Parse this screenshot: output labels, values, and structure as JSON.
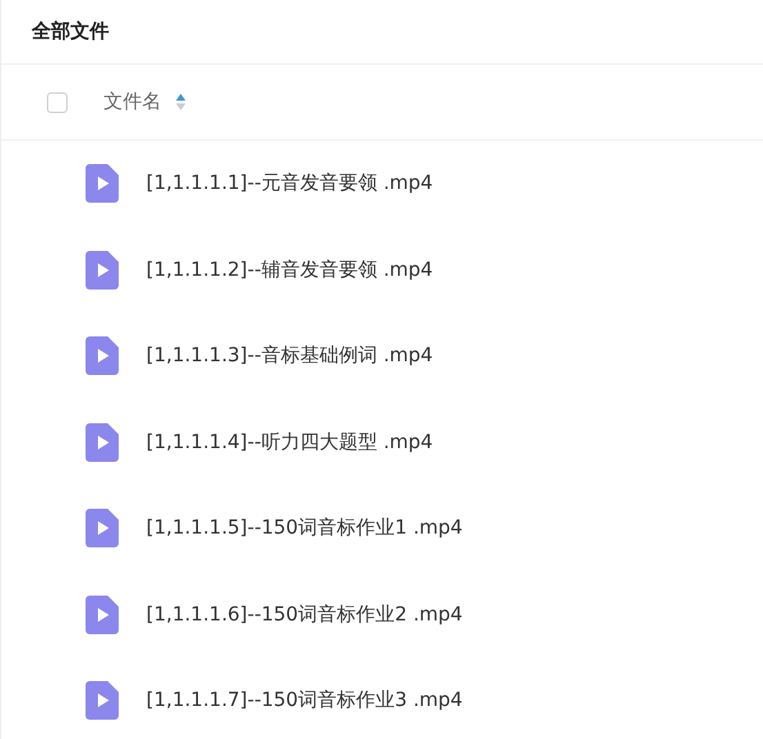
{
  "title": "全部文件",
  "header": {
    "checked": false,
    "column": "文件名",
    "ascending": true
  },
  "files": [
    {
      "name": "[1,1.1.1.1]--元音发音要领 .mp4"
    },
    {
      "name": "[1,1.1.1.2]--辅音发音要领 .mp4"
    },
    {
      "name": "[1,1.1.1.3]--音标基础例词 .mp4"
    },
    {
      "name": "[1,1.1.1.4]--听力四大题型 .mp4"
    },
    {
      "name": "[1,1.1.1.5]--150词音标作业1 .mp4"
    },
    {
      "name": "[1,1.1.1.6]--150词音标作业2 .mp4"
    },
    {
      "name": "[1,1.1.1.7]--150词音标作业3 .mp4"
    }
  ]
}
